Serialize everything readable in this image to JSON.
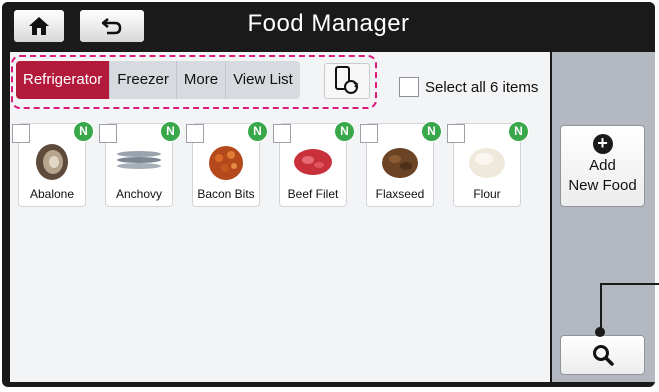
{
  "header": {
    "title": "Food Manager"
  },
  "tabs": [
    {
      "label": "Refrigerator",
      "active": true
    },
    {
      "label": "Freezer",
      "active": false
    },
    {
      "label": "More",
      "active": false
    },
    {
      "label": "View List",
      "active": false
    }
  ],
  "select_all": {
    "label": "Select all 6 items",
    "checked": false
  },
  "items": [
    {
      "name": "Abalone",
      "badge": "N",
      "icon": "abalone-image"
    },
    {
      "name": "Anchovy",
      "badge": "N",
      "icon": "anchovy-image"
    },
    {
      "name": "Bacon Bits",
      "badge": "N",
      "icon": "bacon-bits-image"
    },
    {
      "name": "Beef Filet",
      "badge": "N",
      "icon": "beef-filet-image"
    },
    {
      "name": "Flaxseed",
      "badge": "N",
      "icon": "flaxseed-image"
    },
    {
      "name": "Flour",
      "badge": "N",
      "icon": "flour-image"
    }
  ],
  "sidebar": {
    "add_line1": "Add",
    "add_line2": "New Food"
  },
  "colors": {
    "active_tab": "#b3193a",
    "badge": "#39a84a",
    "highlight_dash": "#d81b7a"
  }
}
